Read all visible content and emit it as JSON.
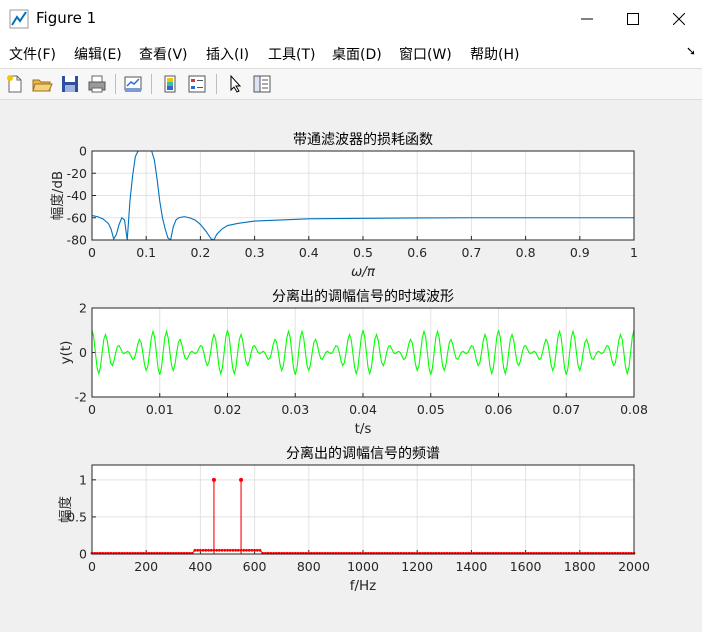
{
  "window": {
    "title": "Figure 1"
  },
  "menu": [
    "文件(F)",
    "编辑(E)",
    "查看(V)",
    "插入(I)",
    "工具(T)",
    "桌面(D)",
    "窗口(W)",
    "帮助(H)"
  ],
  "toolbar_icons": [
    "new-figure-icon",
    "open-file-icon",
    "save-icon",
    "print-icon",
    "link-plot-icon",
    "colorbar-icon",
    "legend-icon",
    "select-arrow-icon",
    "property-inspector-icon"
  ],
  "colors": {
    "line1": "#0072bd",
    "line2": "#00ff00",
    "line3": "#ff0000"
  },
  "chart_data": [
    {
      "type": "line",
      "title": "带通滤波器的损耗函数",
      "xlabel": "ω/π",
      "ylabel": "幅度/dB",
      "xlim": [
        0,
        1
      ],
      "ylim": [
        -80,
        0
      ],
      "xticks": [
        "0",
        "0.1",
        "0.2",
        "0.3",
        "0.4",
        "0.5",
        "0.6",
        "0.7",
        "0.8",
        "0.9",
        "1"
      ],
      "yticks": [
        "0",
        "-20",
        "-40",
        "-60",
        "-80"
      ],
      "grid": true,
      "series": [
        {
          "x": [
            0,
            0.01,
            0.02,
            0.03,
            0.035,
            0.04,
            0.045,
            0.05,
            0.055,
            0.06,
            0.065,
            0.07,
            0.075,
            0.08,
            0.085,
            0.09,
            0.095,
            0.1,
            0.105,
            0.11,
            0.115,
            0.12,
            0.125,
            0.13,
            0.135,
            0.14,
            0.145,
            0.15,
            0.155,
            0.16,
            0.17,
            0.18,
            0.19,
            0.2,
            0.21,
            0.22,
            0.225,
            0.23,
            0.24,
            0.25,
            0.27,
            0.3,
            0.35,
            0.4,
            0.5,
            0.6,
            0.7,
            0.8,
            0.9,
            1.0
          ],
          "y": [
            -58,
            -59,
            -61,
            -65,
            -70,
            -79,
            -75,
            -66,
            -60,
            -62,
            -80,
            -45,
            -22,
            -5,
            0,
            0,
            0,
            0,
            0,
            0,
            -8,
            -25,
            -45,
            -60,
            -70,
            -78,
            -80,
            -68,
            -62,
            -60,
            -59,
            -60,
            -62,
            -66,
            -72,
            -79,
            -80,
            -75,
            -70,
            -67,
            -65,
            -63,
            -62,
            -61,
            -60.5,
            -60.2,
            -60,
            -60,
            -60,
            -60
          ]
        }
      ]
    },
    {
      "type": "line",
      "title": "分离出的调幅信号的时域波形",
      "xlabel": "t/s",
      "ylabel": "y(t)",
      "xlim": [
        0,
        0.08
      ],
      "ylim": [
        -2,
        2
      ],
      "xticks": [
        "0",
        "0.01",
        "0.02",
        "0.03",
        "0.04",
        "0.05",
        "0.06",
        "0.07",
        "0.08"
      ],
      "yticks": [
        "2",
        "0",
        "-2"
      ],
      "grid": true,
      "series": [
        {
          "signal": "am",
          "carrier_hz": 500,
          "mod_hz": 50,
          "amplitude": 1,
          "dt": 0.00025
        }
      ]
    },
    {
      "type": "line",
      "title": "分离出的调幅信号的频谱",
      "xlabel": "f/Hz",
      "ylabel": "幅度",
      "xlim": [
        0,
        2000
      ],
      "ylim": [
        0,
        1.2
      ],
      "xticks": [
        "0",
        "200",
        "400",
        "600",
        "800",
        "1000",
        "1200",
        "1400",
        "1600",
        "1800",
        "2000"
      ],
      "yticks": [
        "1",
        "0.5",
        "0"
      ],
      "grid": true,
      "series": [
        {
          "peaks": [
            {
              "x": 450,
              "y": 1
            },
            {
              "x": 550,
              "y": 1
            }
          ],
          "baseline": 0.01,
          "bump": {
            "from": 380,
            "to": 620,
            "level": 0.05
          }
        }
      ]
    }
  ]
}
